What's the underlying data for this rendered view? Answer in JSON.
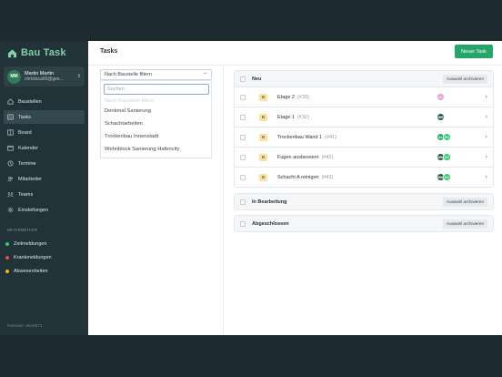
{
  "app": {
    "name": "Bau Task",
    "release": "Release: a5c5671"
  },
  "user": {
    "initials": "MM",
    "name": "Martin Martin",
    "email": "chrisluca00@ges..."
  },
  "nav": [
    {
      "label": "Baustellen",
      "icon": "house-icon",
      "active": false
    },
    {
      "label": "Tasks",
      "icon": "list-icon",
      "active": true
    },
    {
      "label": "Board",
      "icon": "board-icon",
      "active": false
    },
    {
      "label": "Kalender",
      "icon": "calendar-icon",
      "active": false
    },
    {
      "label": "Termine",
      "icon": "clock-icon",
      "active": false
    },
    {
      "label": "Mitarbeiter",
      "icon": "users-icon",
      "active": false
    },
    {
      "label": "Teams",
      "icon": "team-icon",
      "active": false
    },
    {
      "label": "Einstellungen",
      "icon": "settings-icon",
      "active": false
    }
  ],
  "staff_section": {
    "label": "MITARBEITER",
    "items": [
      {
        "label": "Zeitmeldungen",
        "color": "#2ecc71"
      },
      {
        "label": "Krankmeldungen",
        "color": "#e74c3c"
      },
      {
        "label": "Abwesenheiten",
        "color": "#f1b80f"
      }
    ]
  },
  "page": {
    "title": "Tasks",
    "new_task_label": "Neuer Task"
  },
  "filter": {
    "selected": "Nach Baustelle filtern",
    "search_placeholder": "Suchen",
    "options": [
      {
        "label": "Nach Baustelle filtern",
        "disabled": true
      },
      {
        "label": "Denkmal Sanierung",
        "disabled": false
      },
      {
        "label": "Schachtarbeiten",
        "disabled": false
      },
      {
        "label": "Trockenbau Innenstadt",
        "disabled": false
      },
      {
        "label": "Wohnblock Sanierung Hafencity",
        "disabled": false
      }
    ]
  },
  "groups": [
    {
      "title": "Neu",
      "archive_label": "Auswahl archivieren",
      "tasks": [
        {
          "badge": "B",
          "name": "Etage 2",
          "id": "(#33)",
          "assignees": [
            {
              "initials": "JD",
              "color": "#e59ad8"
            }
          ]
        },
        {
          "badge": "B",
          "name": "Etage 1",
          "id": "(#32)",
          "assignees": [
            {
              "initials": "MM",
              "color": "#1f5d3a"
            }
          ]
        },
        {
          "badge": "B",
          "name": "Trockenbau Wand 1",
          "id": "(#41)",
          "assignees": [
            {
              "initials": "AL",
              "color": "#27ae60"
            },
            {
              "initials": "SV",
              "color": "#2ecc71"
            }
          ]
        },
        {
          "badge": "B",
          "name": "Fugen ausbessern",
          "id": "(#42)",
          "assignees": [
            {
              "initials": "MM",
              "color": "#1f5d3a"
            },
            {
              "initials": "SV",
              "color": "#2ecc71"
            }
          ]
        },
        {
          "badge": "B",
          "name": "Schacht A reinigen",
          "id": "(#43)",
          "assignees": [
            {
              "initials": "MM",
              "color": "#1f5d3a"
            },
            {
              "initials": "SV",
              "color": "#2ecc71"
            }
          ]
        }
      ]
    },
    {
      "title": "In Bearbeitung",
      "archive_label": "Auswahl archivieren",
      "tasks": []
    },
    {
      "title": "Abgeschlossen",
      "archive_label": "Auswahl archivieren",
      "tasks": []
    }
  ]
}
